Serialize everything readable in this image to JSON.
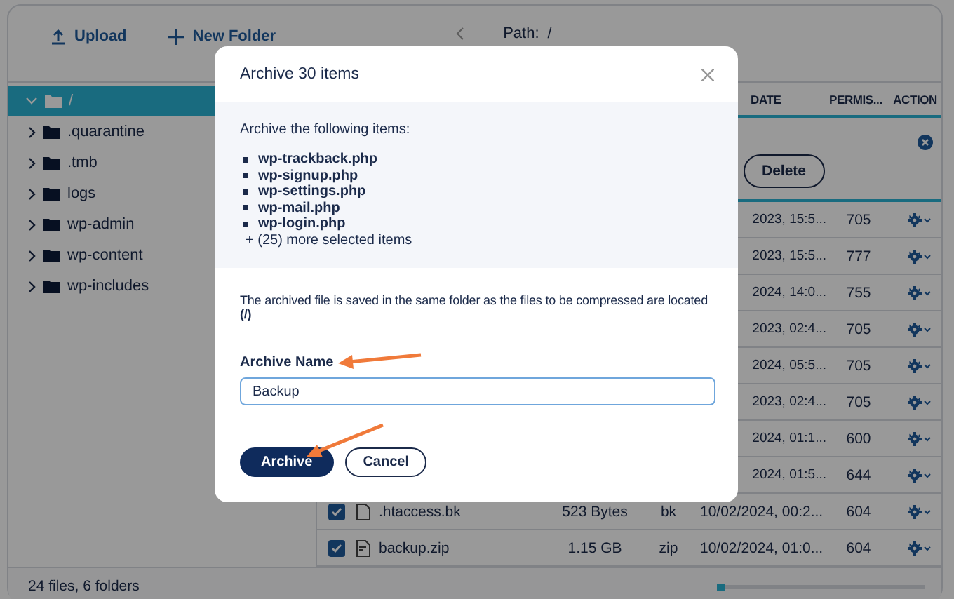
{
  "toolbar": {
    "upload": "Upload",
    "new_folder": "New Folder",
    "path_label": "Path:",
    "path": "/"
  },
  "tree": [
    {
      "label": "/",
      "expanded": true,
      "selected": true,
      "children": [
        {
          "label": ".quarantine",
          "expanded": false,
          "selected": false
        },
        {
          "label": ".tmb",
          "expanded": false,
          "selected": false
        },
        {
          "label": "logs",
          "expanded": false,
          "selected": false
        },
        {
          "label": "wp-admin",
          "expanded": false,
          "selected": false
        },
        {
          "label": "wp-content",
          "expanded": false,
          "selected": false
        },
        {
          "label": "wp-includes",
          "expanded": false,
          "selected": false
        }
      ]
    }
  ],
  "table": {
    "columns": [
      {
        "label": "DATE"
      },
      {
        "label": "PERMIS..."
      },
      {
        "label": "ACTION"
      }
    ],
    "selection_bar": {
      "delete": "Delete"
    },
    "rows": [
      {
        "date": "2023, 15:5...",
        "permissions": "705"
      },
      {
        "date": "2023, 15:5...",
        "permissions": "777"
      },
      {
        "date": "2024, 14:0...",
        "permissions": "755"
      },
      {
        "date": "2023, 02:4...",
        "permissions": "705"
      },
      {
        "date": "2024, 05:5...",
        "permissions": "705"
      },
      {
        "date": "2023, 02:4...",
        "permissions": "705"
      },
      {
        "date": "2024, 01:1...",
        "permissions": "600"
      },
      {
        "date": "2024, 01:5...",
        "permissions": "644"
      },
      {
        "checked": true,
        "kind": "file",
        "name": ".htaccess.bk",
        "size": "523 Bytes",
        "type": "bk",
        "date": "10/02/2024, 00:2...",
        "permissions": "604"
      },
      {
        "checked": true,
        "kind": "zip",
        "name": "backup.zip",
        "size": "1.15 GB",
        "type": "zip",
        "date": "10/02/2024, 01:0...",
        "permissions": "604"
      }
    ]
  },
  "status_bar": {
    "summary": "24 files, 6 folders"
  },
  "dialog": {
    "title": "Archive 30 items",
    "intro": "Archive the following items:",
    "items": [
      "wp-trackback.php",
      "wp-signup.php",
      "wp-settings.php",
      "wp-mail.php",
      "wp-login.php"
    ],
    "more": "+ (25) more selected items",
    "note": "The archived file is saved in the same folder as the files to be compressed are located **(/)**",
    "field_label": "Archive Name",
    "field_value": "Backup",
    "buttons": [
      {
        "label": "Archive",
        "kind": "primary"
      },
      {
        "label": "Cancel",
        "kind": "secondary"
      }
    ]
  }
}
